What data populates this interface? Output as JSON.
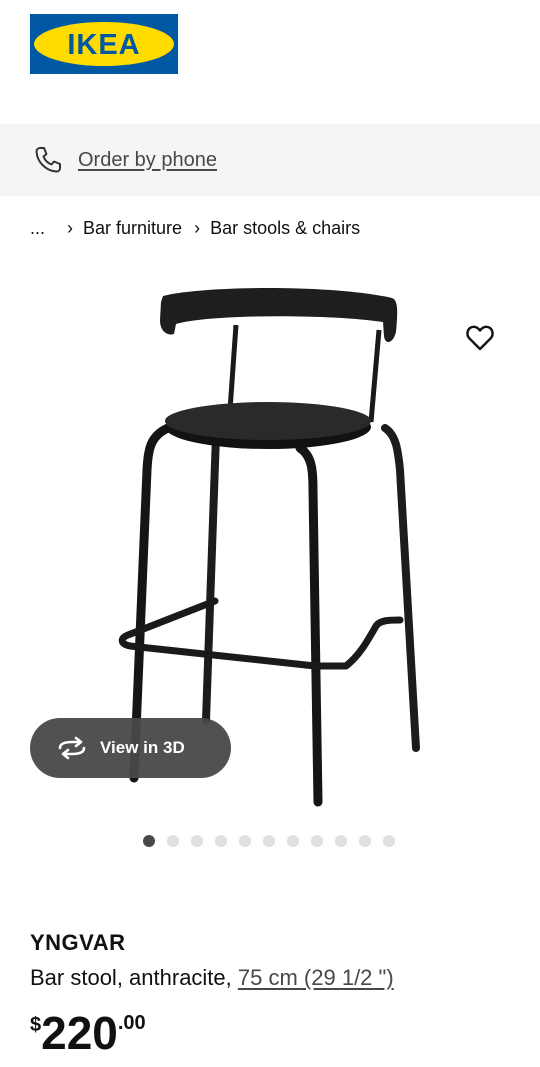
{
  "brand": {
    "logo_text": "IKEA",
    "blue": "#0058a3",
    "yellow": "#ffdb00"
  },
  "phone_bar": {
    "label": "Order by phone",
    "icon": "phone-icon"
  },
  "breadcrumb": {
    "ellipsis": "...",
    "items": [
      "Bar furniture",
      "Bar stools & chairs"
    ],
    "separator": "›"
  },
  "gallery": {
    "view_3d_label": "View in 3D",
    "favorite_icon": "heart-icon",
    "dot_count": 11,
    "active_dot": 0
  },
  "product": {
    "name": "YNGVAR",
    "description": "Bar stool, anthracite,",
    "measurement": "75 cm (29 1/2 \")",
    "price_currency": "$",
    "price_integer": "220",
    "price_decimal": ".00"
  }
}
